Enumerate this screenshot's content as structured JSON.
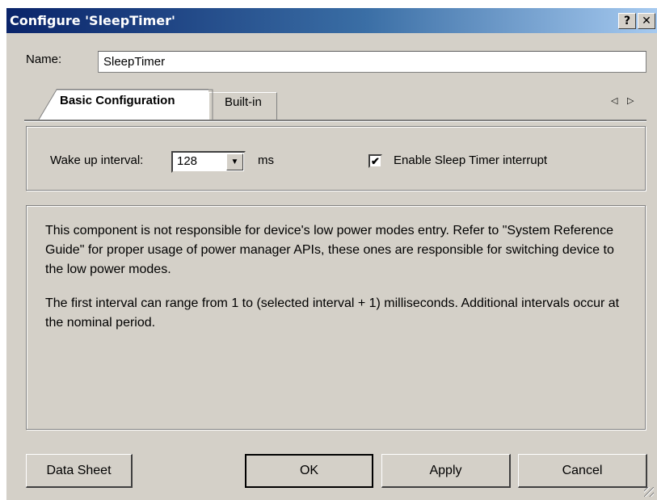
{
  "window": {
    "title": "Configure 'SleepTimer'",
    "help_button": "?",
    "close_button": "✕"
  },
  "name_field": {
    "label": "Name:",
    "value": "SleepTimer"
  },
  "tabs": [
    {
      "label": "Basic Configuration",
      "active": true
    },
    {
      "label": "Built-in",
      "active": false
    }
  ],
  "tab_scroll": {
    "left": "◁",
    "right": "▷"
  },
  "config": {
    "wake_label": "Wake up interval:",
    "wake_value": "128",
    "wake_unit": "ms",
    "interrupt_label": "Enable Sleep Timer interrupt",
    "interrupt_checked": true,
    "check_glyph": "✔"
  },
  "description": [
    "This component is not responsible for device's low power modes entry. Refer to \"System Reference Guide\" for proper usage of power manager APIs, these ones are responsible for switching device to the low power modes.",
    "The first interval can range from 1 to (selected interval + 1) milliseconds. Additional intervals occur at the nominal period."
  ],
  "buttons": {
    "datasheet": "Data Sheet",
    "ok": "OK",
    "apply": "Apply",
    "cancel": "Cancel"
  },
  "colors": {
    "titlebar_start": "#0a246a",
    "titlebar_end": "#a6caf0",
    "dialog_bg": "#d4d0c8"
  }
}
